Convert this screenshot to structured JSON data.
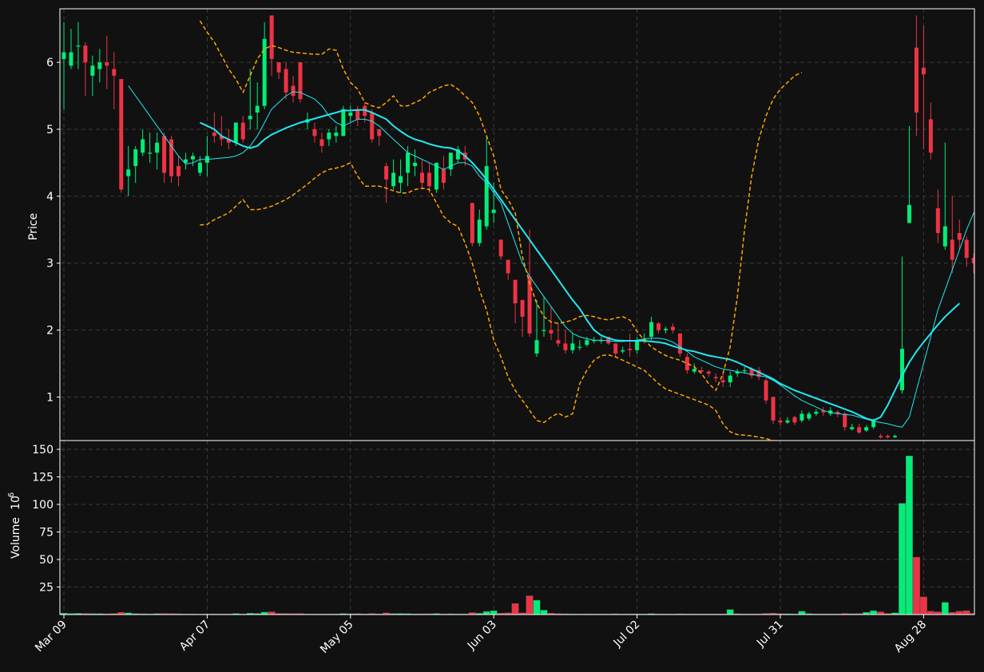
{
  "theme": {
    "background": "#111111",
    "frame": "#ffffff",
    "grid": "#3a3a3a",
    "up_color": "#00ee77",
    "down_color": "#ee3344",
    "band_color": "#ffa500",
    "ma_color": "#22e8f0"
  },
  "chart_data": {
    "type": "candlestick",
    "ylabel_price": "Price",
    "ylabel_volume": "Volume",
    "ylabel_volume_exp": "6",
    "xtick_labels": [
      "Mar 09",
      "Apr 07",
      "May 05",
      "Jun 03",
      "Jul 02",
      "Jul 31",
      "Aug 28"
    ],
    "xtick_index": [
      0,
      20,
      40,
      60,
      80,
      100,
      120
    ],
    "price_yticks": [
      1,
      2,
      3,
      4,
      5,
      6
    ],
    "price_ylim": [
      0.35,
      6.8
    ],
    "volume_yticks": [
      25,
      50,
      75,
      100,
      125,
      150
    ],
    "volume_ylim": [
      0,
      158
    ],
    "grid": true,
    "candles": [
      [
        6.05,
        6.15,
        6.6,
        5.3,
        1.3
      ],
      [
        5.95,
        6.15,
        6.5,
        5.9,
        0.9
      ],
      [
        6.25,
        6.25,
        6.6,
        5.9,
        1.1
      ],
      [
        6.25,
        6.0,
        6.3,
        5.5,
        1.0
      ],
      [
        5.8,
        5.95,
        6.1,
        5.5,
        0.8
      ],
      [
        5.9,
        6.0,
        6.2,
        5.7,
        0.8
      ],
      [
        6.0,
        5.95,
        6.4,
        5.6,
        0.7
      ],
      [
        5.9,
        5.8,
        6.15,
        5.3,
        0.9
      ],
      [
        5.75,
        4.1,
        5.75,
        4.05,
        2.0
      ],
      [
        4.3,
        4.4,
        4.75,
        4.0,
        1.5
      ],
      [
        4.45,
        4.7,
        4.75,
        4.2,
        0.8
      ],
      [
        4.65,
        4.85,
        5.0,
        4.6,
        0.7
      ],
      [
        4.65,
        4.65,
        4.95,
        4.5,
        0.6
      ],
      [
        4.65,
        4.8,
        4.95,
        4.4,
        0.8
      ],
      [
        4.9,
        4.35,
        4.95,
        4.2,
        0.9
      ],
      [
        4.85,
        4.3,
        4.9,
        4.2,
        0.8
      ],
      [
        4.45,
        4.3,
        4.6,
        4.15,
        0.7
      ],
      [
        4.5,
        4.55,
        4.65,
        4.4,
        0.5
      ],
      [
        4.55,
        4.6,
        4.65,
        4.45,
        0.5
      ],
      [
        4.35,
        4.5,
        4.6,
        4.3,
        0.4
      ],
      [
        4.5,
        4.6,
        4.9,
        4.3,
        0.5
      ],
      [
        4.95,
        4.9,
        5.25,
        4.8,
        0.6
      ],
      [
        4.9,
        4.85,
        5.2,
        4.75,
        0.5
      ],
      [
        4.85,
        4.8,
        5.0,
        4.7,
        0.5
      ],
      [
        4.8,
        5.1,
        5.1,
        4.75,
        0.9
      ],
      [
        5.1,
        4.85,
        5.2,
        4.8,
        0.6
      ],
      [
        5.15,
        5.2,
        5.9,
        5.0,
        1.2
      ],
      [
        5.25,
        5.35,
        5.7,
        5.0,
        1.0
      ],
      [
        5.35,
        6.35,
        6.6,
        5.3,
        2.2
      ],
      [
        6.7,
        6.05,
        6.7,
        5.8,
        2.5
      ],
      [
        6.0,
        5.85,
        6.0,
        5.75,
        1.0
      ],
      [
        5.9,
        5.55,
        6.0,
        5.45,
        0.9
      ],
      [
        5.65,
        5.5,
        5.8,
        5.4,
        0.8
      ],
      [
        6.0,
        5.45,
        6.0,
        5.4,
        0.9
      ],
      [
        5.1,
        5.15,
        5.25,
        5.0,
        0.5
      ],
      [
        5.0,
        4.9,
        5.1,
        4.8,
        0.5
      ],
      [
        4.85,
        4.75,
        4.95,
        4.65,
        0.5
      ],
      [
        4.85,
        4.95,
        5.0,
        4.75,
        0.5
      ],
      [
        4.9,
        4.95,
        5.05,
        4.8,
        0.6
      ],
      [
        4.9,
        5.3,
        5.35,
        4.9,
        0.9
      ],
      [
        5.2,
        5.25,
        5.35,
        5.1,
        0.7
      ],
      [
        5.3,
        5.15,
        5.35,
        5.05,
        0.8
      ],
      [
        5.35,
        5.2,
        5.4,
        5.1,
        0.6
      ],
      [
        5.25,
        4.85,
        5.3,
        4.8,
        0.9
      ],
      [
        5.0,
        4.9,
        5.0,
        4.75,
        0.6
      ],
      [
        4.45,
        4.25,
        4.5,
        3.9,
        1.5
      ],
      [
        4.15,
        4.35,
        4.55,
        4.1,
        0.8
      ],
      [
        4.2,
        4.3,
        4.55,
        4.05,
        0.9
      ],
      [
        4.35,
        4.65,
        4.75,
        4.15,
        0.8
      ],
      [
        4.45,
        4.5,
        4.7,
        4.3,
        0.6
      ],
      [
        4.35,
        4.2,
        4.55,
        4.1,
        0.7
      ],
      [
        4.35,
        4.15,
        4.5,
        4.05,
        0.7
      ],
      [
        4.1,
        4.5,
        4.5,
        4.05,
        0.9
      ],
      [
        4.4,
        4.2,
        4.6,
        4.1,
        0.6
      ],
      [
        4.4,
        4.65,
        4.65,
        4.3,
        0.7
      ],
      [
        4.55,
        4.7,
        4.75,
        4.5,
        0.6
      ],
      [
        4.65,
        4.55,
        4.75,
        4.45,
        0.6
      ],
      [
        3.9,
        3.3,
        3.9,
        3.25,
        1.8
      ],
      [
        3.3,
        3.65,
        3.8,
        3.25,
        1.1
      ],
      [
        3.55,
        4.45,
        4.9,
        3.5,
        2.8
      ],
      [
        3.75,
        3.8,
        4.2,
        3.6,
        3.5
      ],
      [
        3.35,
        3.1,
        3.35,
        3.05,
        1.2
      ],
      [
        3.05,
        2.85,
        3.05,
        2.75,
        1.5
      ],
      [
        2.75,
        2.4,
        2.75,
        2.1,
        10.0
      ],
      [
        2.45,
        2.2,
        2.45,
        1.9,
        1.5
      ],
      [
        2.8,
        1.95,
        3.5,
        1.9,
        17.0
      ],
      [
        1.65,
        1.85,
        2.45,
        1.6,
        13.0
      ],
      [
        2.0,
        2.0,
        2.5,
        1.9,
        4.0
      ],
      [
        2.0,
        1.95,
        2.35,
        1.85,
        1.2
      ],
      [
        1.85,
        1.8,
        2.1,
        1.75,
        0.8
      ],
      [
        1.8,
        1.7,
        2.0,
        1.65,
        0.7
      ],
      [
        1.7,
        1.8,
        1.95,
        1.65,
        0.6
      ],
      [
        1.75,
        1.75,
        1.85,
        1.7,
        0.5
      ],
      [
        1.78,
        1.85,
        1.9,
        1.75,
        0.6
      ],
      [
        1.85,
        1.85,
        1.9,
        1.8,
        0.5
      ],
      [
        1.85,
        1.85,
        1.9,
        1.8,
        0.5
      ],
      [
        1.9,
        1.8,
        1.9,
        1.78,
        0.5
      ],
      [
        1.8,
        1.65,
        1.8,
        1.6,
        0.7
      ],
      [
        1.68,
        1.7,
        1.75,
        1.65,
        0.5
      ],
      [
        1.72,
        1.7,
        1.95,
        1.6,
        0.6
      ],
      [
        1.7,
        1.85,
        1.9,
        1.65,
        0.6
      ],
      [
        1.85,
        1.87,
        1.95,
        1.8,
        0.5
      ],
      [
        1.9,
        2.12,
        2.2,
        1.85,
        0.8
      ],
      [
        2.1,
        2.0,
        2.12,
        1.95,
        0.6
      ],
      [
        2.0,
        2.02,
        2.05,
        1.95,
        0.5
      ],
      [
        2.05,
        2.0,
        2.1,
        1.95,
        0.5
      ],
      [
        1.95,
        1.65,
        1.95,
        1.6,
        0.7
      ],
      [
        1.6,
        1.4,
        1.65,
        1.35,
        0.6
      ],
      [
        1.38,
        1.42,
        1.5,
        1.35,
        0.5
      ],
      [
        1.4,
        1.38,
        1.45,
        1.35,
        0.5
      ],
      [
        1.38,
        1.35,
        1.4,
        1.3,
        0.5
      ],
      [
        1.3,
        1.28,
        1.35,
        1.22,
        0.5
      ],
      [
        1.25,
        1.22,
        1.35,
        1.15,
        0.5
      ],
      [
        1.22,
        1.32,
        1.38,
        1.15,
        4.5
      ],
      [
        1.35,
        1.38,
        1.42,
        1.3,
        0.7
      ],
      [
        1.4,
        1.4,
        1.45,
        1.35,
        0.6
      ],
      [
        1.42,
        1.32,
        1.45,
        1.28,
        0.6
      ],
      [
        1.4,
        1.3,
        1.45,
        1.25,
        0.6
      ],
      [
        1.25,
        0.95,
        1.28,
        0.9,
        1.0
      ],
      [
        1.0,
        0.65,
        1.0,
        0.6,
        1.2
      ],
      [
        0.65,
        0.62,
        0.7,
        0.58,
        0.8
      ],
      [
        0.62,
        0.65,
        0.7,
        0.6,
        0.7
      ],
      [
        0.7,
        0.62,
        0.72,
        0.58,
        0.6
      ],
      [
        0.65,
        0.75,
        0.8,
        0.62,
        3.0
      ],
      [
        0.68,
        0.75,
        0.78,
        0.65,
        0.8
      ],
      [
        0.75,
        0.78,
        0.82,
        0.72,
        0.6
      ],
      [
        0.8,
        0.77,
        0.85,
        0.72,
        0.6
      ],
      [
        0.75,
        0.8,
        0.85,
        0.72,
        0.6
      ],
      [
        0.78,
        0.75,
        0.8,
        0.7,
        0.5
      ],
      [
        0.75,
        0.55,
        0.78,
        0.5,
        1.0
      ],
      [
        0.52,
        0.55,
        0.6,
        0.5,
        0.7
      ],
      [
        0.55,
        0.47,
        0.6,
        0.45,
        0.9
      ],
      [
        0.5,
        0.55,
        0.58,
        0.48,
        2.0
      ],
      [
        0.55,
        0.65,
        0.68,
        0.52,
        3.5
      ],
      [
        0.42,
        0.4,
        0.45,
        0.38,
        2.5
      ],
      [
        0.42,
        0.4,
        0.44,
        0.38,
        1.0
      ],
      [
        0.4,
        0.42,
        0.44,
        0.39,
        1.5
      ],
      [
        1.1,
        1.72,
        3.1,
        1.05,
        101.0
      ],
      [
        3.6,
        3.87,
        5.05,
        3.6,
        144.0
      ],
      [
        6.22,
        5.25,
        6.7,
        4.9,
        52.0
      ],
      [
        5.92,
        5.82,
        6.55,
        4.7,
        16.0
      ],
      [
        5.15,
        4.65,
        5.4,
        4.55,
        3.0
      ],
      [
        3.82,
        3.45,
        4.1,
        3.3,
        2.5
      ],
      [
        3.25,
        3.55,
        4.8,
        3.2,
        11.0
      ],
      [
        3.35,
        3.05,
        4.0,
        2.85,
        2.0
      ],
      [
        3.45,
        3.35,
        3.65,
        3.2,
        3.0
      ],
      [
        3.35,
        3.08,
        3.4,
        2.95,
        3.5
      ],
      [
        3.08,
        3.0,
        3.15,
        2.85,
        1.0
      ],
      [
        2.88,
        2.95,
        3.15,
        2.8,
        0.5
      ]
    ],
    "series": [
      {
        "name": "",
        "values": [
          null,
          null,
          null,
          null,
          null,
          null,
          null,
          null,
          null,
          5.65,
          5.5,
          5.35,
          5.2,
          5.05,
          4.9,
          4.75,
          4.6,
          4.48,
          4.5,
          4.55,
          4.55,
          4.56,
          4.57,
          4.58,
          4.6,
          4.65,
          4.75,
          4.9,
          5.1,
          5.3,
          5.4,
          5.5,
          5.56,
          5.55,
          5.5,
          5.45,
          5.35,
          5.2,
          5.1,
          5.05,
          5.1,
          5.15,
          5.15,
          5.12,
          5.05,
          4.95,
          4.85,
          4.75,
          4.65,
          4.6,
          4.55,
          4.5,
          4.45,
          4.4,
          4.45,
          4.5,
          4.5,
          4.45,
          4.3,
          4.2,
          4.05,
          3.9,
          3.6,
          3.3,
          3.0,
          2.8,
          2.65,
          2.5,
          2.35,
          2.2,
          2.05,
          1.95,
          1.9,
          1.87,
          1.85,
          1.85,
          1.84,
          1.83,
          1.83,
          1.84,
          1.85,
          1.87,
          1.88,
          1.88,
          1.86,
          1.82,
          1.75,
          1.68,
          1.6,
          1.55,
          1.5,
          1.45,
          1.42,
          1.4,
          1.38,
          1.36,
          1.34,
          1.32,
          1.3,
          1.25,
          1.18,
          1.1,
          1.02,
          0.95,
          0.9,
          0.85,
          0.8,
          0.77,
          0.75,
          0.74,
          0.73,
          0.7,
          0.67,
          0.64,
          0.62,
          0.6,
          0.57,
          0.55,
          0.7,
          1.1,
          1.5,
          1.9,
          2.3,
          2.6,
          2.9,
          3.2,
          3.5,
          3.75,
          3.88,
          3.82
        ]
      },
      {
        "name": "",
        "values": [
          null,
          null,
          null,
          null,
          null,
          null,
          null,
          null,
          null,
          null,
          null,
          null,
          null,
          null,
          null,
          null,
          null,
          null,
          null,
          5.1,
          5.05,
          5.0,
          4.9,
          4.85,
          4.8,
          4.75,
          4.72,
          4.75,
          4.85,
          4.92,
          4.97,
          5.02,
          5.06,
          5.1,
          5.13,
          5.16,
          5.19,
          5.22,
          5.25,
          5.28,
          5.28,
          5.29,
          5.29,
          5.25,
          5.2,
          5.15,
          5.05,
          4.97,
          4.9,
          4.85,
          4.82,
          4.78,
          4.75,
          4.73,
          4.72,
          4.68,
          4.6,
          4.5,
          4.38,
          4.25,
          4.1,
          3.95,
          3.8,
          3.65,
          3.5,
          3.35,
          3.2,
          3.05,
          2.9,
          2.75,
          2.6,
          2.45,
          2.32,
          2.15,
          2.0,
          1.92,
          1.88,
          1.85,
          1.84,
          1.84,
          1.84,
          1.84,
          1.83,
          1.82,
          1.8,
          1.76,
          1.73,
          1.7,
          1.68,
          1.65,
          1.62,
          1.6,
          1.58,
          1.56,
          1.52,
          1.47,
          1.42,
          1.37,
          1.32,
          1.27,
          1.2,
          1.15,
          1.1,
          1.06,
          1.02,
          0.98,
          0.94,
          0.9,
          0.86,
          0.82,
          0.78,
          0.73,
          0.68,
          0.65,
          0.7,
          0.88,
          1.1,
          1.32,
          1.52,
          1.68,
          1.82,
          1.95,
          2.08,
          2.2,
          2.3,
          2.4
        ]
      },
      {
        "name": "",
        "values": [
          null,
          null,
          null,
          null,
          null,
          null,
          null,
          null,
          null,
          null,
          null,
          null,
          null,
          null,
          null,
          null,
          null,
          null,
          null,
          6.62,
          6.45,
          6.3,
          6.1,
          5.9,
          5.75,
          5.55,
          5.8,
          6.05,
          6.2,
          6.25,
          6.22,
          6.18,
          6.15,
          6.14,
          6.13,
          6.12,
          6.12,
          6.2,
          6.18,
          5.9,
          5.7,
          5.6,
          5.4,
          5.35,
          5.32,
          5.4,
          5.5,
          5.35,
          5.35,
          5.4,
          5.45,
          5.55,
          5.6,
          5.65,
          5.67,
          5.6,
          5.5,
          5.4,
          5.2,
          4.9,
          4.6,
          4.1,
          3.95,
          3.75,
          3.1,
          2.7,
          2.4,
          2.2,
          2.12,
          2.1,
          2.12,
          2.15,
          2.2,
          2.22,
          2.2,
          2.17,
          2.15,
          2.18,
          2.2,
          2.15,
          1.98,
          1.85,
          1.75,
          1.68,
          1.62,
          1.58,
          1.55,
          1.5,
          1.45,
          1.35,
          1.2,
          1.1,
          1.35,
          1.75,
          2.5,
          3.5,
          4.3,
          4.85,
          5.2,
          5.45,
          5.6,
          5.7,
          5.8,
          5.85
        ]
      },
      {
        "name": "",
        "values": [
          null,
          null,
          null,
          null,
          null,
          null,
          null,
          null,
          null,
          null,
          null,
          null,
          null,
          null,
          null,
          null,
          null,
          null,
          null,
          3.57,
          3.58,
          3.65,
          3.7,
          3.75,
          3.85,
          3.95,
          3.8,
          3.8,
          3.82,
          3.85,
          3.9,
          3.95,
          4.02,
          4.1,
          4.18,
          4.27,
          4.35,
          4.4,
          4.42,
          4.45,
          4.5,
          4.3,
          4.15,
          4.15,
          4.15,
          4.12,
          4.08,
          4.05,
          4.05,
          4.1,
          4.12,
          4.1,
          3.9,
          3.7,
          3.6,
          3.55,
          3.3,
          3.0,
          2.6,
          2.3,
          1.85,
          1.6,
          1.3,
          1.1,
          0.95,
          0.8,
          0.65,
          0.62,
          0.7,
          0.76,
          0.7,
          0.75,
          1.2,
          1.4,
          1.55,
          1.62,
          1.63,
          1.6,
          1.55,
          1.5,
          1.45,
          1.4,
          1.3,
          1.2,
          1.12,
          1.08,
          1.04,
          1.0,
          0.96,
          0.92,
          0.88,
          0.8,
          0.6,
          0.48,
          0.44,
          0.43,
          0.42,
          0.4,
          0.38,
          0.35,
          0.32
        ]
      }
    ]
  }
}
